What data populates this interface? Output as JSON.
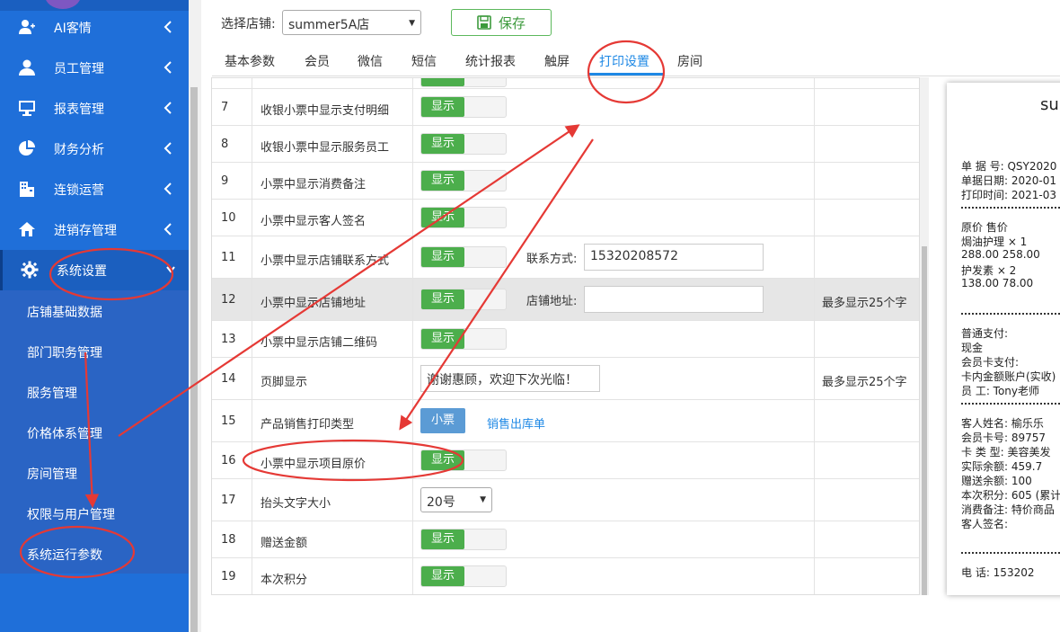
{
  "sidebar": {
    "menu": [
      {
        "label": "AI客情",
        "icon": "user-plus-icon"
      },
      {
        "label": "员工管理",
        "icon": "user-icon"
      },
      {
        "label": "报表管理",
        "icon": "monitor-icon"
      },
      {
        "label": "财务分析",
        "icon": "pie-chart-icon"
      },
      {
        "label": "连锁运营",
        "icon": "building-icon"
      },
      {
        "label": "进销存管理",
        "icon": "home-icon"
      },
      {
        "label": "系统设置",
        "icon": "gear-icon"
      }
    ],
    "submenu": [
      "店铺基础数据",
      "部门职务管理",
      "服务管理",
      "价格体系管理",
      "房间管理",
      "权限与用户管理",
      "系统运行参数"
    ]
  },
  "top": {
    "store_label": "选择店铺:",
    "store_value": "summer5A店",
    "save_label": "保存"
  },
  "tabs": [
    "基本参数",
    "会员",
    "微信",
    "短信",
    "统计报表",
    "触屏",
    "打印设置",
    "房间"
  ],
  "active_tab": "打印设置",
  "toggle_label": "显示",
  "rows": [
    {
      "num": "7",
      "name": "收银小票中显示支付明细"
    },
    {
      "num": "8",
      "name": "收银小票中显示服务员工"
    },
    {
      "num": "9",
      "name": "小票中显示消费备注"
    },
    {
      "num": "10",
      "name": "小票中显示客人签名"
    },
    {
      "num": "11",
      "name": "小票中显示店铺联系方式",
      "field_label": "联系方式:",
      "field_value": "15320208572"
    },
    {
      "num": "12",
      "name": "小票中显示店铺地址",
      "field_label": "店铺地址:",
      "field_value": "",
      "note": "最多显示25个字"
    },
    {
      "num": "13",
      "name": "小票中显示店铺二维码"
    },
    {
      "num": "14",
      "name": "页脚显示",
      "input_value": "谢谢惠顾，欢迎下次光临！",
      "note": "最多显示25个字"
    },
    {
      "num": "15",
      "name": "产品销售打印类型",
      "button": "小票",
      "link": "销售出库单"
    },
    {
      "num": "16",
      "name": "小票中显示项目原价"
    },
    {
      "num": "17",
      "name": "抬头文字大小",
      "select": "20号"
    },
    {
      "num": "18",
      "name": "赠送金额"
    },
    {
      "num": "19",
      "name": "本次积分"
    }
  ],
  "receipt": {
    "title": "su",
    "lines": [
      "单 据 号:   QSY2020",
      "单据日期:   2020-01",
      "打印时间:   2021-03",
      "原价          售价",
      "焗油护理      × 1",
      "288.00          258.00",
      "护发素      × 2",
      "138.00          78.00",
      "普通支付:",
      "现金",
      "会员卡支付:",
      "卡内金额账户(实收)",
      "员     工:   Tony老师",
      "客人姓名:   榆乐乐",
      "会员卡号:   89757",
      "卡 类 型:   美容美发",
      "实际余额:   459.7",
      "赠送余额:   100",
      "本次积分:   605 (累计",
      "消费备注:   特价商品",
      "客人签名:",
      "电     话:   153202"
    ]
  },
  "colors": {
    "sidebar": "#1f6fd9",
    "toggle_on": "#4cae4c",
    "accent": "#1e88e5",
    "annotation": "#e53935"
  }
}
